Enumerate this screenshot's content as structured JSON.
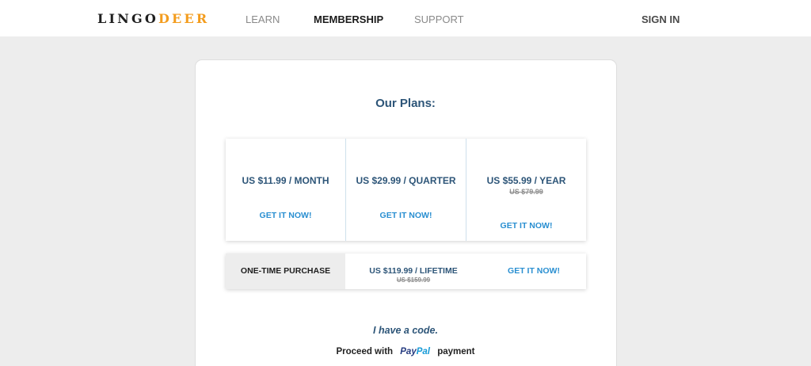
{
  "header": {
    "logo_main": "LINGO",
    "logo_accent": "DEER",
    "nav": {
      "learn": "LEARN",
      "membership": "MEMBERSHIP",
      "support": "SUPPORT",
      "sign_in": "SIGN IN"
    }
  },
  "main": {
    "title": "Our Plans:",
    "plans": [
      {
        "price": "US $11.99 / MONTH",
        "old_price": "",
        "cta": "GET IT NOW!"
      },
      {
        "price": "US $29.99 / QUARTER",
        "old_price": "",
        "cta": "GET IT NOW!"
      },
      {
        "price": "US $55.99 / YEAR",
        "old_price": "US $79.99",
        "cta": "GET IT NOW!"
      }
    ],
    "one_time": {
      "label": "ONE-TIME PURCHASE",
      "price": "US $119.99 / LIFETIME",
      "old_price": "US $159.99",
      "cta": "GET IT NOW!"
    },
    "code_link": "I have a code.",
    "paypal": {
      "prefix": "Proceed with",
      "logo_pay": "Pay",
      "logo_pal": "Pal",
      "suffix": "payment"
    }
  },
  "colors": {
    "accent": "#f39c1d",
    "heading_blue": "#2d5578",
    "link_blue": "#2a8fd1",
    "page_bg": "#ededed"
  }
}
